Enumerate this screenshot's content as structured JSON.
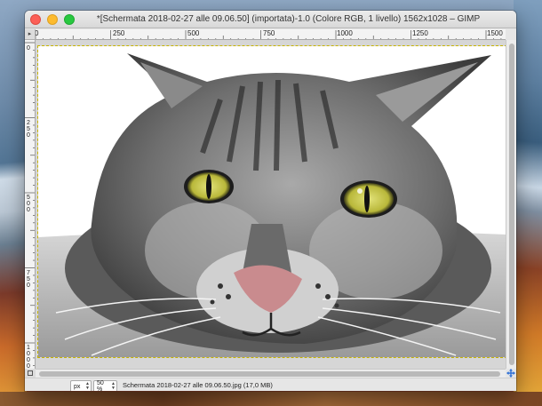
{
  "window": {
    "title": "*[Schermata 2018-02-27 alle 09.06.50] (importata)-1.0 (Colore RGB, 1 livello) 1562x1028 – GIMP"
  },
  "rulers": {
    "corner_glyph": "▸",
    "horizontal_labels": [
      "0",
      "250",
      "500",
      "750",
      "1000",
      "1250",
      "1500"
    ],
    "vertical_labels": [
      "0",
      "250",
      "500",
      "750",
      "1000"
    ]
  },
  "statusbar": {
    "unit": "px",
    "zoom": "50 %",
    "info": "Schermata 2018-02-27 alle 09.06.50.jpg (17,0 MB)"
  },
  "icons": {
    "close": "close-dot",
    "minimize": "minimize-dot",
    "maximize": "maximize-dot",
    "navigate": "move-cross-icon",
    "quickmask": "quick-mask-icon"
  },
  "colors": {
    "selection_outline": "#c8b400",
    "navigate_icon": "#2d6fd6",
    "cat_eye": "#c9c93a",
    "cat_nose": "#c98b8e"
  }
}
